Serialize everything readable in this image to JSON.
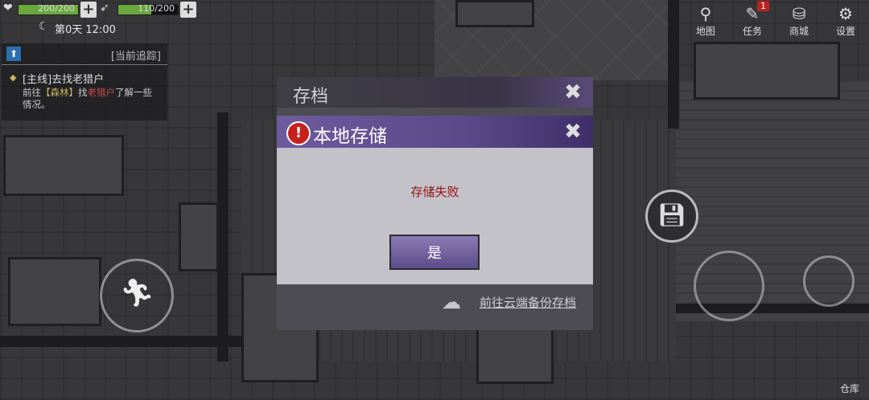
{
  "hud": {
    "health": {
      "current": 200,
      "max": 200,
      "text": "200/200",
      "icon": "heart-icon"
    },
    "stamina": {
      "current": 110,
      "max": 200,
      "text": "110/200",
      "icon": "foot-icon"
    },
    "time_text": "第0天 12:00"
  },
  "top_menu": [
    {
      "label": "地图",
      "icon": "map-icon",
      "badge": ""
    },
    {
      "label": "任务",
      "icon": "task-icon",
      "badge": "1"
    },
    {
      "label": "商城",
      "icon": "shop-icon",
      "badge": ""
    },
    {
      "label": "设置",
      "icon": "gear-icon",
      "badge": ""
    }
  ],
  "quest": {
    "tracking_label": "[当前追踪]",
    "title": "[主线]去找老猎户",
    "desc_prefix": "前往",
    "desc_location": "【森林】",
    "desc_mid": "找",
    "desc_person": "老猎户",
    "desc_suffix": "了解一些情况。"
  },
  "storage_label": "仓库",
  "save_dialog": {
    "title": "存档",
    "cloud_link": "前往云端备份存档"
  },
  "local_dialog": {
    "title": "本地存储",
    "message": "存储失败",
    "confirm_label": "是"
  },
  "colors": {
    "dialog_accent": "#5a4988",
    "error_text": "#9a1010",
    "health_bar": "#6aa83e"
  }
}
